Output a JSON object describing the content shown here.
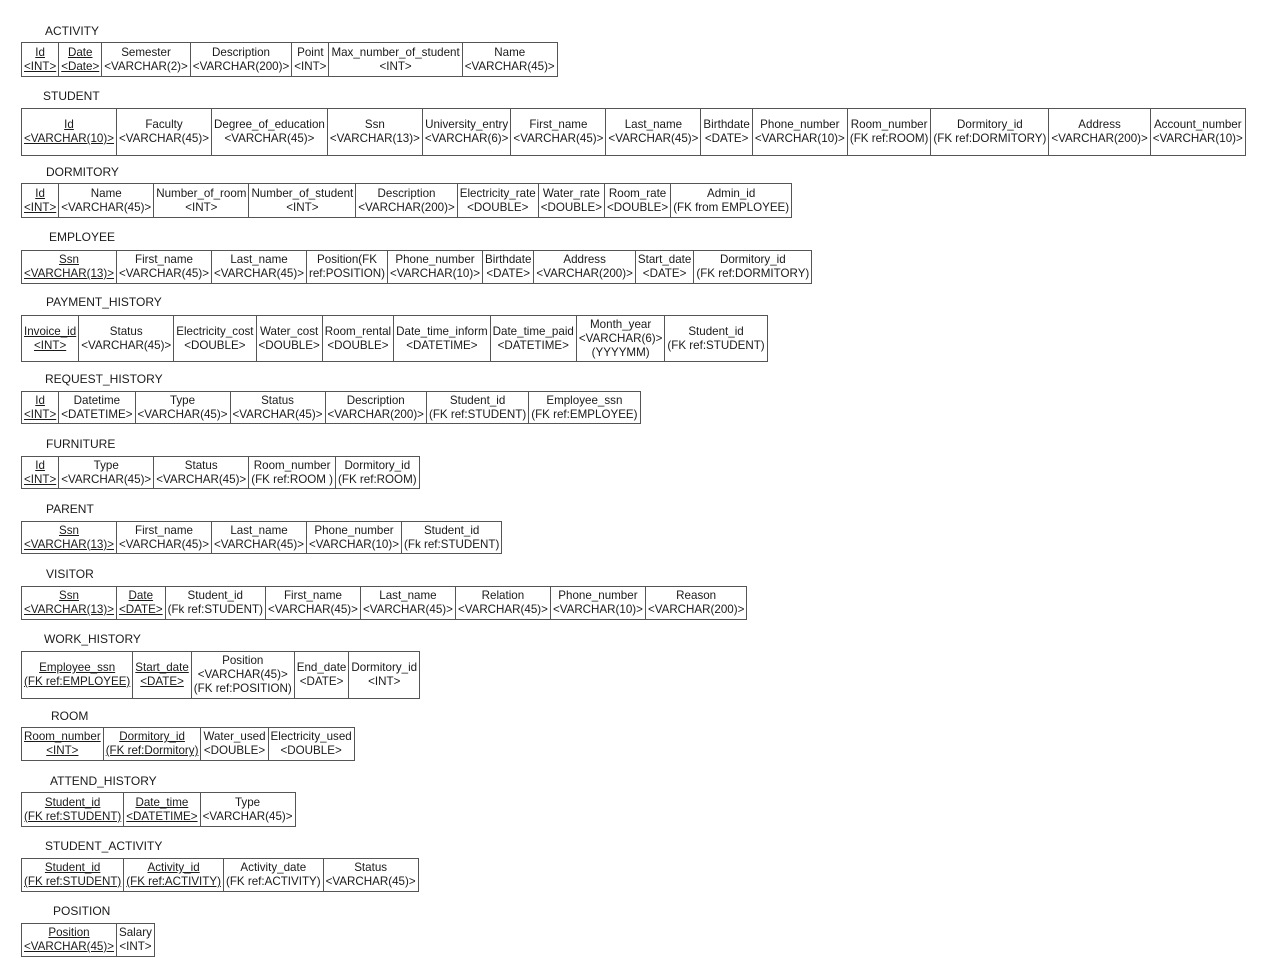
{
  "tables": [
    {
      "name": "ACTIVITY",
      "columns": [
        {
          "lines": [
            "Id",
            "<INT>"
          ],
          "pk": true
        },
        {
          "lines": [
            "Date",
            "<Date>"
          ],
          "pk": true
        },
        {
          "lines": [
            "Semester",
            "<VARCHAR(2)>"
          ]
        },
        {
          "lines": [
            "Description",
            "<VARCHAR(200)>"
          ]
        },
        {
          "lines": [
            "Point",
            "<INT>"
          ]
        },
        {
          "lines": [
            "Max_number_of_student",
            "<INT>"
          ]
        },
        {
          "lines": [
            "Name",
            "<VARCHAR(45)>"
          ]
        }
      ]
    },
    {
      "name": "STUDENT",
      "columns": [
        {
          "lines": [
            "Id",
            "<VARCHAR(10)>"
          ],
          "pk": true
        },
        {
          "lines": [
            "Faculty",
            "<VARCHAR(45)>"
          ]
        },
        {
          "lines": [
            "Degree_of_education",
            "<VARCHAR(45)>"
          ]
        },
        {
          "lines": [
            "Ssn",
            "<VARCHAR(13)>"
          ]
        },
        {
          "lines": [
            "University_entry",
            "<VARCHAR(6)>"
          ]
        },
        {
          "lines": [
            "First_name",
            "<VARCHAR(45)>"
          ]
        },
        {
          "lines": [
            "Last_name",
            "<VARCHAR(45)>"
          ]
        },
        {
          "lines": [
            "Birthdate",
            "<DATE>"
          ]
        },
        {
          "lines": [
            "Phone_number",
            "<VARCHAR(10)>"
          ]
        },
        {
          "lines": [
            "Room_number",
            "(FK ref:ROOM)"
          ]
        },
        {
          "lines": [
            "Dormitory_id",
            "(FK ref:DORMITORY)"
          ]
        },
        {
          "lines": [
            "Address",
            "<VARCHAR(200)>"
          ]
        },
        {
          "lines": [
            "Account_number",
            "<VARCHAR(10)>"
          ]
        }
      ]
    },
    {
      "name": "DORMITORY",
      "columns": [
        {
          "lines": [
            "Id",
            "<INT>"
          ],
          "pk": true
        },
        {
          "lines": [
            "Name",
            "<VARCHAR(45)>"
          ]
        },
        {
          "lines": [
            "Number_of_room",
            "<INT>"
          ]
        },
        {
          "lines": [
            "Number_of_student",
            "<INT>"
          ]
        },
        {
          "lines": [
            "Description",
            "<VARCHAR(200)>"
          ]
        },
        {
          "lines": [
            "Electricity_rate",
            "<DOUBLE>"
          ]
        },
        {
          "lines": [
            "Water_rate",
            "<DOUBLE>"
          ]
        },
        {
          "lines": [
            "Room_rate",
            "<DOUBLE>"
          ]
        },
        {
          "lines": [
            "Admin_id",
            "(FK from EMPLOYEE)"
          ]
        }
      ]
    },
    {
      "name": "EMPLOYEE",
      "columns": [
        {
          "lines": [
            "Ssn",
            "<VARCHAR(13)>"
          ],
          "pk": true
        },
        {
          "lines": [
            "First_name",
            "<VARCHAR(45)>"
          ]
        },
        {
          "lines": [
            "Last_name",
            "<VARCHAR(45)>"
          ]
        },
        {
          "lines": [
            "Position(FK",
            "ref:POSITION)"
          ]
        },
        {
          "lines": [
            "Phone_number",
            "<VARCHAR(10)>"
          ]
        },
        {
          "lines": [
            "Birthdate",
            "<DATE>"
          ]
        },
        {
          "lines": [
            "Address",
            "<VARCHAR(200)>"
          ]
        },
        {
          "lines": [
            "Start_date",
            "<DATE>"
          ]
        },
        {
          "lines": [
            "Dormitory_id",
            "(FK ref:DORMITORY)"
          ]
        }
      ]
    },
    {
      "name": "PAYMENT_HISTORY",
      "columns": [
        {
          "lines": [
            "Invoice_id",
            "<INT>"
          ],
          "pk": true
        },
        {
          "lines": [
            "Status",
            "<VARCHAR(45)>"
          ]
        },
        {
          "lines": [
            "Electricity_cost",
            "<DOUBLE>"
          ]
        },
        {
          "lines": [
            "Water_cost",
            "<DOUBLE>"
          ]
        },
        {
          "lines": [
            "Room_rental",
            "<DOUBLE>"
          ]
        },
        {
          "lines": [
            "Date_time_inform",
            "<DATETIME>"
          ]
        },
        {
          "lines": [
            "Date_time_paid",
            "<DATETIME>"
          ]
        },
        {
          "lines": [
            "Month_year",
            "<VARCHAR(6)>",
            "(YYYYMM)"
          ]
        },
        {
          "lines": [
            "Student_id",
            "(FK ref:STUDENT)"
          ]
        }
      ]
    },
    {
      "name": "REQUEST_HISTORY",
      "columns": [
        {
          "lines": [
            "Id",
            "<INT>"
          ],
          "pk": true
        },
        {
          "lines": [
            "Datetime",
            "<DATETIME>"
          ]
        },
        {
          "lines": [
            "Type",
            "<VARCHAR(45)>"
          ]
        },
        {
          "lines": [
            "Status",
            "<VARCHAR(45)>"
          ]
        },
        {
          "lines": [
            "Description",
            "<VARCHAR(200)>"
          ]
        },
        {
          "lines": [
            "Student_id",
            "(FK ref:STUDENT)"
          ]
        },
        {
          "lines": [
            "Employee_ssn",
            "(FK ref:EMPLOYEE)"
          ]
        }
      ]
    },
    {
      "name": "FURNITURE",
      "columns": [
        {
          "lines": [
            "Id",
            "<INT>"
          ],
          "pk": true
        },
        {
          "lines": [
            "Type",
            "<VARCHAR(45)>"
          ]
        },
        {
          "lines": [
            "Status",
            "<VARCHAR(45)>"
          ]
        },
        {
          "lines": [
            "Room_number",
            "(FK ref:ROOM )"
          ]
        },
        {
          "lines": [
            "Dormitory_id",
            "(FK ref:ROOM)"
          ]
        }
      ]
    },
    {
      "name": "PARENT",
      "columns": [
        {
          "lines": [
            "Ssn",
            "<VARCHAR(13)>"
          ],
          "pk": true
        },
        {
          "lines": [
            "First_name",
            "<VARCHAR(45)>"
          ]
        },
        {
          "lines": [
            "Last_name",
            "<VARCHAR(45)>"
          ]
        },
        {
          "lines": [
            "Phone_number",
            "<VARCHAR(10)>"
          ]
        },
        {
          "lines": [
            "Student_id",
            "(Fk ref:STUDENT)"
          ]
        }
      ]
    },
    {
      "name": "VISITOR",
      "columns": [
        {
          "lines": [
            "Ssn",
            "<VARCHAR(13)>"
          ],
          "pk": true
        },
        {
          "lines": [
            "Date",
            "<DATE>"
          ],
          "pk": true
        },
        {
          "lines": [
            "Student_id",
            "(Fk ref:STUDENT)"
          ]
        },
        {
          "lines": [
            "First_name",
            "<VARCHAR(45)>"
          ]
        },
        {
          "lines": [
            "Last_name",
            "<VARCHAR(45)>"
          ]
        },
        {
          "lines": [
            "Relation",
            "<VARCHAR(45)>"
          ]
        },
        {
          "lines": [
            "Phone_number",
            "<VARCHAR(10)>"
          ]
        },
        {
          "lines": [
            "Reason",
            "<VARCHAR(200)>"
          ]
        }
      ]
    },
    {
      "name": "WORK_HISTORY",
      "columns": [
        {
          "lines": [
            "Employee_ssn",
            "(FK ref:EMPLOYEE)"
          ],
          "pk": true
        },
        {
          "lines": [
            "Start_date",
            "<DATE>"
          ],
          "pk": true
        },
        {
          "lines": [
            "Position",
            "<VARCHAR(45)>",
            "(FK ref:POSITION)"
          ]
        },
        {
          "lines": [
            "End_date",
            "<DATE>"
          ]
        },
        {
          "lines": [
            "Dormitory_id",
            "<INT>"
          ]
        }
      ]
    },
    {
      "name": "ROOM",
      "columns": [
        {
          "lines": [
            "Room_number",
            "<INT>"
          ],
          "pk": true
        },
        {
          "lines": [
            "Dormitory_id",
            "(FK ref:Dormitory)"
          ],
          "pk": true
        },
        {
          "lines": [
            "Water_used",
            "<DOUBLE>"
          ]
        },
        {
          "lines": [
            "Electricity_used",
            "<DOUBLE>"
          ]
        }
      ]
    },
    {
      "name": "ATTEND_HISTORY",
      "columns": [
        {
          "lines": [
            "Student_id",
            "(FK ref:STUDENT)"
          ],
          "pk": true
        },
        {
          "lines": [
            "Date_time",
            "<DATETIME>"
          ],
          "pk": true
        },
        {
          "lines": [
            "Type",
            "<VARCHAR(45)>"
          ]
        }
      ]
    },
    {
      "name": "STUDENT_ACTIVITY",
      "columns": [
        {
          "lines": [
            "Student_id",
            "(FK ref:STUDENT)"
          ],
          "pk": true
        },
        {
          "lines": [
            "Activity_id",
            "(FK ref:ACTIVITY)"
          ],
          "pk": true
        },
        {
          "lines": [
            "Activity_date",
            "(FK ref:ACTIVITY)"
          ]
        },
        {
          "lines": [
            "Status",
            "<VARCHAR(45)>"
          ]
        }
      ]
    },
    {
      "name": "POSITION",
      "columns": [
        {
          "lines": [
            "Position",
            "<VARCHAR(45)>"
          ],
          "pk": true
        },
        {
          "lines": [
            "Salary",
            "<INT>"
          ]
        }
      ]
    }
  ]
}
